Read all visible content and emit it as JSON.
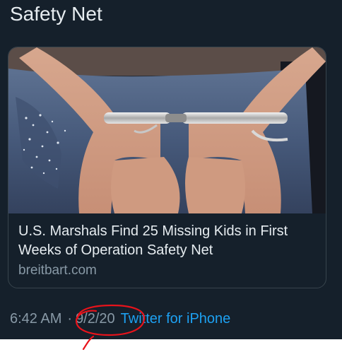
{
  "tweet": {
    "text_tail": "Safety Net",
    "card": {
      "image_alt": "person's hands in handcuffs behind back",
      "title": "U.S. Marshals Find 25 Missing Kids in First Weeks of Operation Safety Net",
      "domain": "breitbart.com"
    },
    "meta": {
      "time": "6:42 AM",
      "separator": "·",
      "date": "9/2/20",
      "source": "Twitter for iPhone"
    }
  },
  "annotation": {
    "shape": "hand-drawn-circle",
    "color": "#e8131b",
    "target": "tweet.meta.date"
  },
  "colors": {
    "background": "#15202b",
    "text": "#e6ecf0",
    "muted": "#8899a6",
    "link": "#1da1f2",
    "border": "#38444d"
  }
}
